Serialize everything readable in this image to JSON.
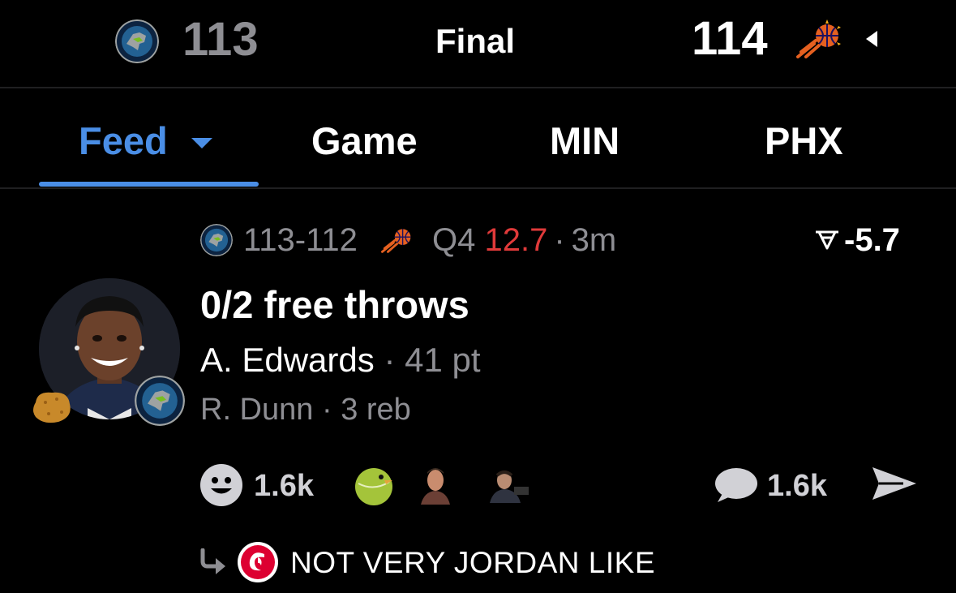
{
  "scoreboard": {
    "away_team": "MIN",
    "away_score": "113",
    "status": "Final",
    "home_score": "114",
    "home_team": "PHX"
  },
  "tabs": [
    {
      "label": "Feed",
      "active": true
    },
    {
      "label": "Game",
      "active": false
    },
    {
      "label": "MIN",
      "active": false
    },
    {
      "label": "PHX",
      "active": false
    }
  ],
  "post": {
    "score_line": "113-112",
    "quarter": "Q4",
    "clock": "12.7",
    "dot": "·",
    "time_ago": "3m",
    "odds": "-5.7",
    "headline": "0/2 free throws",
    "player": "A. Edwards",
    "player_stat": "41 pt",
    "assist_player": "R. Dunn",
    "assist_stat": "3 reb",
    "reaction_count": "1.6k",
    "comment_count": "1.6k",
    "reply_text": "NOT VERY JORDAN LIKE"
  },
  "colors": {
    "accent": "#4a8ee6",
    "clock": "#e03a3a",
    "muted": "#8e8e93",
    "wolves_navy": "#1f3b63",
    "suns_orange": "#e56020"
  },
  "icons": {
    "timberwolves_logo": "timberwolves-logo",
    "suns_logo": "suns-logo",
    "possession": "triangle-left-icon",
    "dropdown": "caret-down-icon",
    "odds": "odds-icon",
    "reaction": "smiley-icon",
    "comment": "speech-bubble-icon",
    "share": "paper-plane-icon",
    "reply": "reply-arrow-icon",
    "chickfila": "chickfila-avatar"
  }
}
